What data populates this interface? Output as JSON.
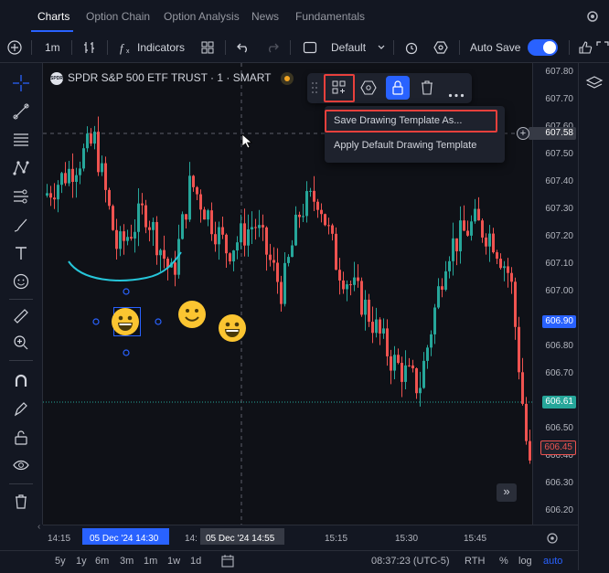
{
  "nav": {
    "tabs": [
      "Charts",
      "Option Chain",
      "Option Analysis",
      "News",
      "Fundamentals"
    ]
  },
  "toolbar": {
    "interval": "1m",
    "indicators": "Indicators",
    "layout": "Default",
    "autosave": "Auto Save",
    "autosave_on": true
  },
  "symbol": {
    "title": "SPDR S&P 500 ETF TRUST · 1 · SMART",
    "logo_text": "SPDR"
  },
  "float_menu": {
    "items": [
      "Save Drawing Template As...",
      "Apply Default Drawing Template"
    ]
  },
  "price_axis": {
    "ticks": [
      "607.80",
      "607.70",
      "607.60",
      "607.50",
      "607.40",
      "607.30",
      "607.20",
      "607.10",
      "607.00",
      "606.90",
      "606.80",
      "606.70",
      "606.61",
      "606.50",
      "606.45",
      "606.40",
      "606.30",
      "606.20"
    ],
    "crosshair_price": "607.58",
    "badge_blue": "606.90",
    "badge_green": "606.61",
    "badge_red": "606.45"
  },
  "time_axis": {
    "ticks": [
      "14:15",
      "05 Dec '24  14:30",
      "14:",
      "05 Dec '24  14:55",
      "15:15",
      "15:30",
      "15:45"
    ]
  },
  "bottom": {
    "ranges": [
      "5y",
      "1y",
      "6m",
      "3m",
      "1m",
      "1w",
      "1d"
    ],
    "clock": "08:37:23 (UTC-5)",
    "session": "RTH",
    "pct": "%",
    "log": "log",
    "auto": "auto"
  },
  "colors": {
    "up": "#26a69a",
    "down": "#ef5350",
    "accent": "#2962ff",
    "highlight": "#e8403c"
  }
}
